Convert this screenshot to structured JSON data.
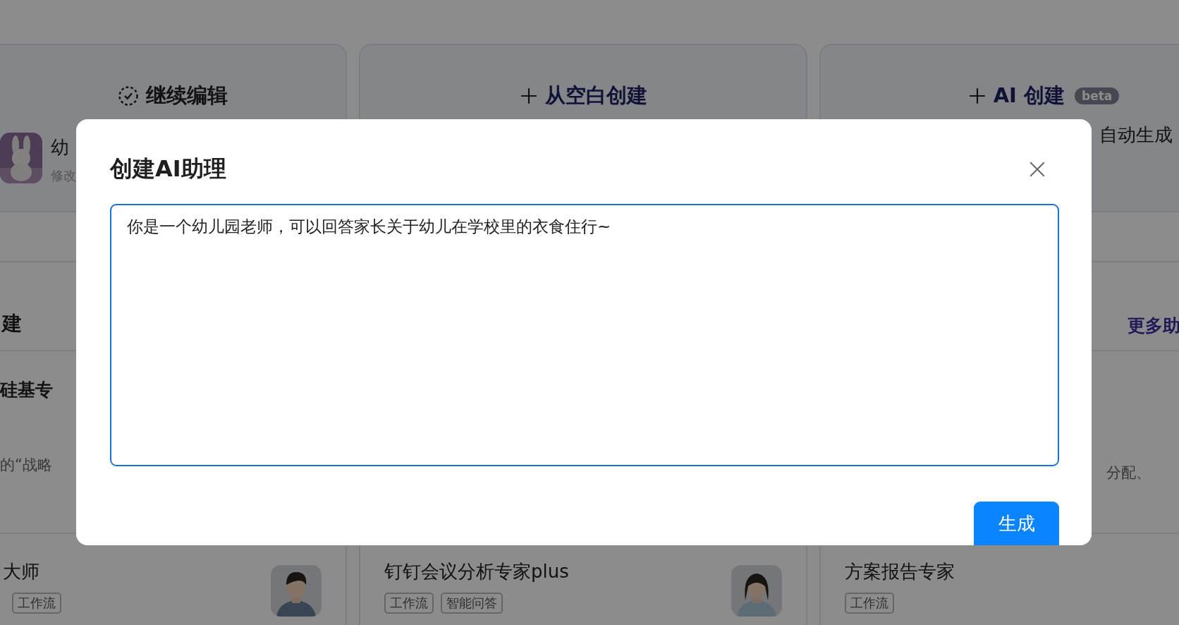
{
  "background": {
    "top_cards": [
      {
        "kind": "continue",
        "title": "继续编辑",
        "item": {
          "name": "幼",
          "meta": "修改",
          "avatar": {
            "kind": "picture"
          }
        }
      },
      {
        "kind": "blank",
        "title": "从空白创建"
      },
      {
        "kind": "ai",
        "title": "AI 创建",
        "badge": "beta",
        "note": "自动生成"
      }
    ],
    "section": {
      "title": "建",
      "more_link": "更多助"
    },
    "row_2": {
      "left": {
        "title": "硅基专",
        "description": "的“战略"
      },
      "right": {
        "description": "分配、"
      }
    },
    "row_3": [
      {
        "title": "大师",
        "tags": [
          "工作流"
        ],
        "avatar": {
          "kind": "picture"
        }
      },
      {
        "title": "钉钉会议分析专家plus",
        "tags": [
          "工作流",
          "智能问答"
        ],
        "avatar": {
          "kind": "picture"
        }
      },
      {
        "title": "方案报告专家",
        "tags": [
          "工作流"
        ]
      }
    ]
  },
  "dialog": {
    "title": "创建AI助理",
    "prompt": "你是一个幼儿园老师，可以回答家长关于幼儿在学校里的衣食住行~",
    "button": "生成"
  }
}
